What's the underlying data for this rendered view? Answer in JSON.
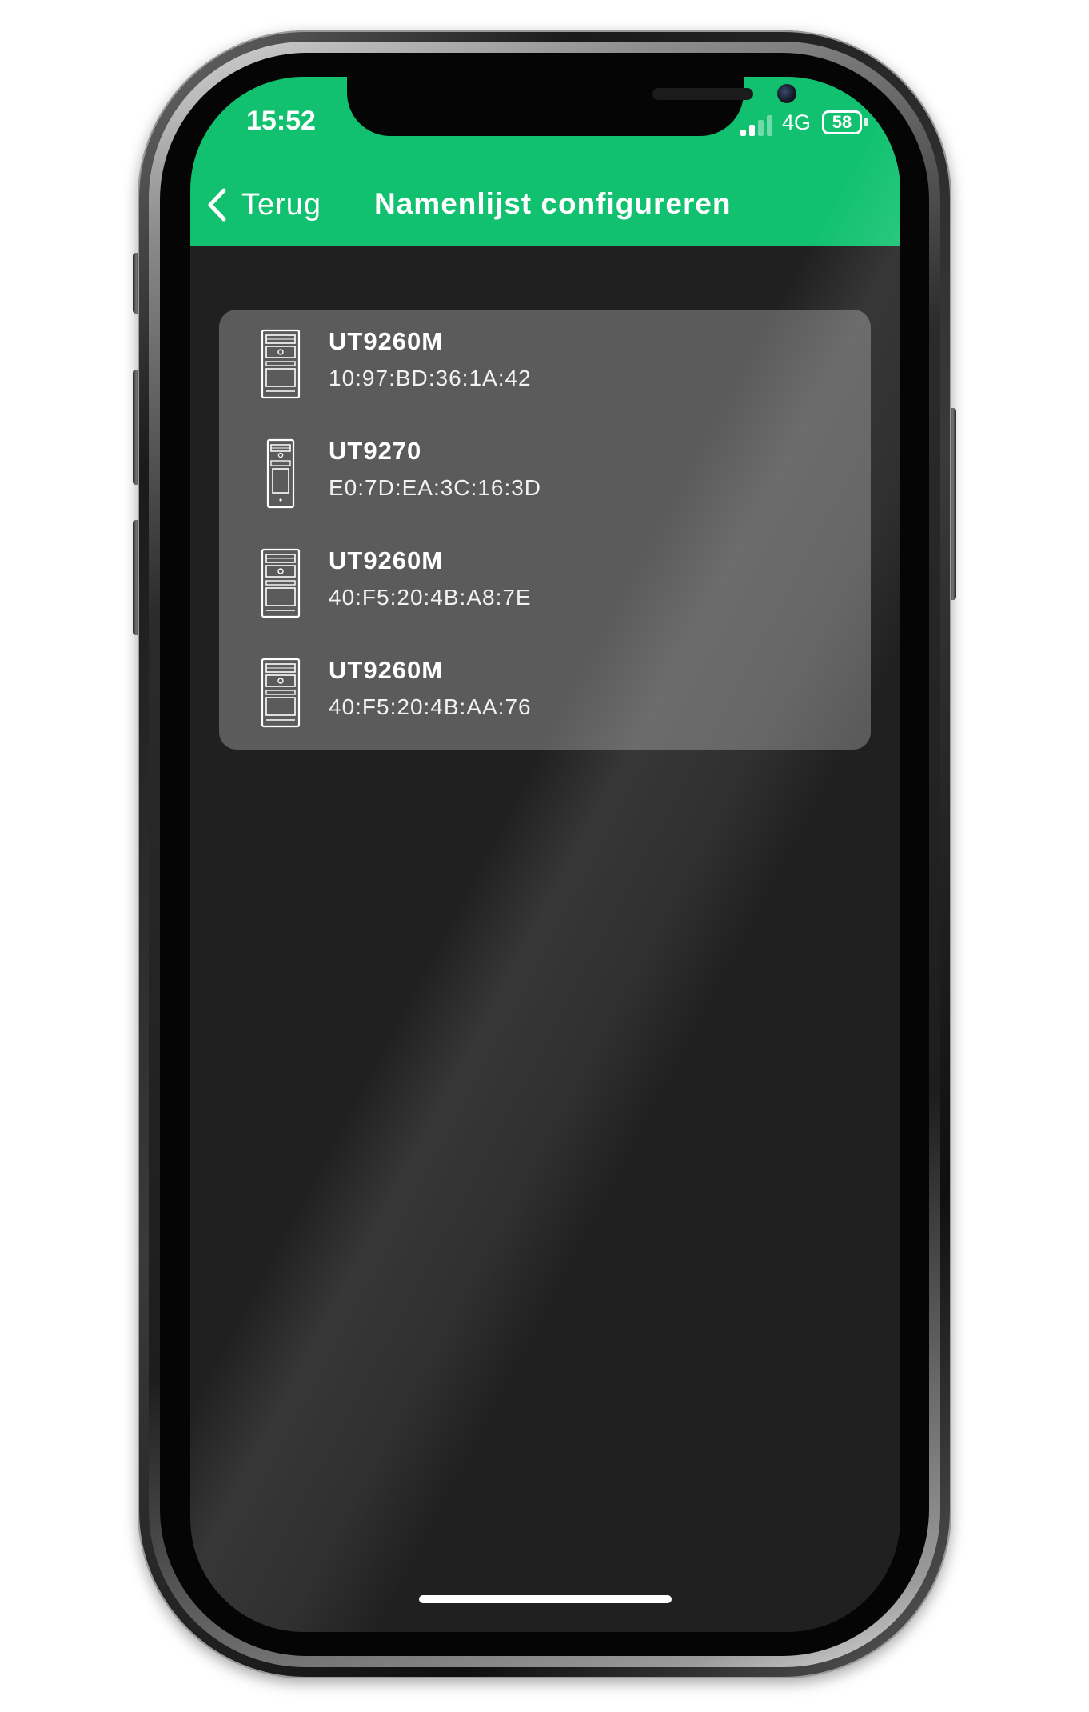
{
  "status_bar": {
    "time": "15:52",
    "network": "4G",
    "battery_level": "58",
    "battery_color": "#11c16f",
    "signal_bars_active": 2,
    "signal_bars_total": 4
  },
  "nav": {
    "back_label": "Terug",
    "title": "Namenlijst configureren",
    "background_color": "#11c16f"
  },
  "devices": [
    {
      "name": "UT9260M",
      "mac": "10:97:BD:36:1A:42",
      "icon": "door-panel-icon"
    },
    {
      "name": "UT9270",
      "mac": "E0:7D:EA:3C:16:3D",
      "icon": "slim-door-panel-icon"
    },
    {
      "name": "UT9260M",
      "mac": "40:F5:20:4B:A8:7E",
      "icon": "door-panel-icon"
    },
    {
      "name": "UT9260M",
      "mac": "40:F5:20:4B:AA:76",
      "icon": "door-panel-icon"
    }
  ],
  "colors": {
    "screen_background": "#202020",
    "list_card": "#5b5b5b"
  }
}
